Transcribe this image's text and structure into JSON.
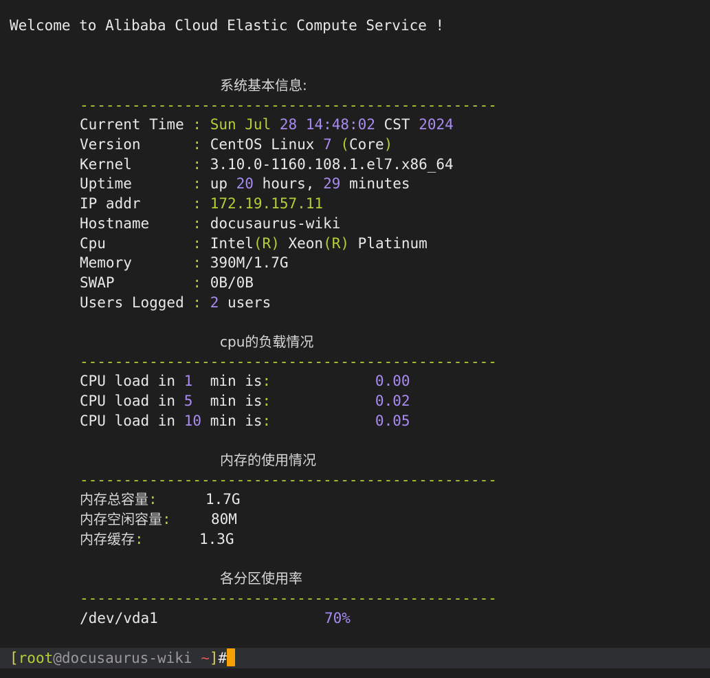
{
  "colors": {
    "background": "#1e1e1e",
    "text": "#e8e8e8",
    "green": "#b5cf37",
    "purple": "#a88bf0",
    "cursor": "#f4a000",
    "prompt_bar": "#2e2f33"
  },
  "welcome": "Welcome to Alibaba Cloud Elastic Compute Service !",
  "sys": {
    "title": "系统基本信息:",
    "divider": "------------------------------------------------",
    "current_time": {
      "label": "Current Time",
      "sep": ":",
      "day": "Sun",
      "month": "Jul",
      "date": "28",
      "time": "14:48:02",
      "tz": "CST",
      "year": "2024"
    },
    "version": {
      "label": "Version",
      "sep": ":",
      "os": "CentOS Linux",
      "num": "7",
      "open": "(",
      "core": "Core",
      "close": ")"
    },
    "kernel": {
      "label": "Kernel",
      "sep": ":",
      "value": "3.10.0-1160.108.1.el7.x86_64"
    },
    "uptime": {
      "label": "Uptime",
      "sep": ":",
      "up": "up",
      "hours": "20",
      "hours_word": "hours,",
      "minutes": "29",
      "minutes_word": "minutes"
    },
    "ip": {
      "label": "IP addr",
      "sep": ":",
      "value": "172.19.157.11"
    },
    "hostname": {
      "label": "Hostname",
      "sep": ":",
      "value": "docusaurus-wiki"
    },
    "cpu": {
      "label": "Cpu",
      "sep": ":",
      "intel": "Intel",
      "r1": "(R)",
      "xeon": "Xeon",
      "r2": "(R)",
      "platinum": "Platinum"
    },
    "memory": {
      "label": "Memory",
      "sep": ":",
      "value": "390M/1.7G"
    },
    "swap": {
      "label": "SWAP",
      "sep": ":",
      "value": "0B/0B"
    },
    "users": {
      "label": "Users Logged",
      "sep": ":",
      "count": "2",
      "word": "users"
    }
  },
  "cpu_load": {
    "title": "cpu的负载情况",
    "divider": "------------------------------------------------",
    "rows": [
      {
        "prefix": "CPU load in",
        "n": "1",
        "suffix": "min is",
        "colon": ":",
        "value": "0.00"
      },
      {
        "prefix": "CPU load in",
        "n": "5",
        "suffix": "min is",
        "colon": ":",
        "value": "0.02"
      },
      {
        "prefix": "CPU load in",
        "n": "10",
        "suffix": "min is",
        "colon": ":",
        "value": "0.05"
      }
    ]
  },
  "mem": {
    "title": "内存的使用情况",
    "divider": "------------------------------------------------",
    "rows": [
      {
        "label": "内存总容量",
        "colon": ":",
        "value": "1.7G"
      },
      {
        "label": "内存空闲容量",
        "colon": ":",
        "value": "80M"
      },
      {
        "label": "内存缓存",
        "colon": ":",
        "value": "1.3G"
      }
    ]
  },
  "disk": {
    "title": "各分区使用率",
    "divider": "------------------------------------------------",
    "rows": [
      {
        "device": "/dev/vda1",
        "usage": "70%"
      }
    ]
  },
  "prompt": {
    "open": "[",
    "user": "root",
    "at": "@",
    "host": "docusaurus-wiki",
    "path": "~",
    "close": "]",
    "symbol": "#"
  }
}
